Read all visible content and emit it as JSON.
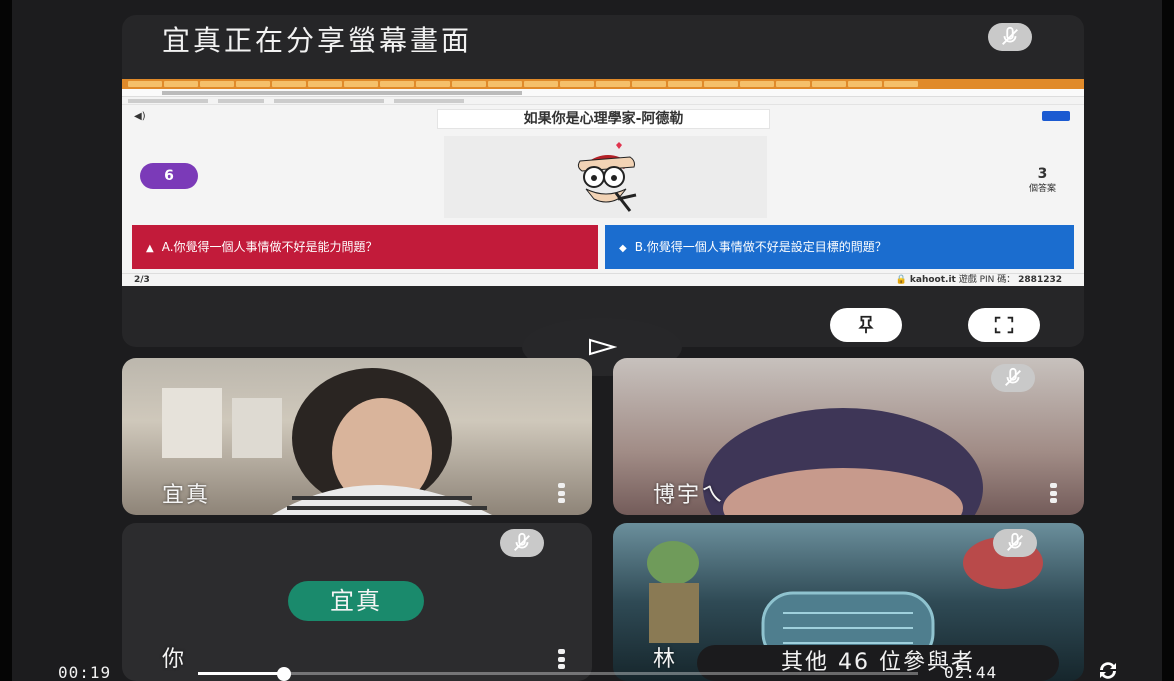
{
  "share": {
    "title": "宜真正在分享螢幕畫面"
  },
  "kahoot": {
    "question_title": "如果你是心理學家-阿德勒",
    "timer": "6",
    "answers_count": "3",
    "answers_label": "個答案",
    "answer_a": "A.你覺得一個人事情做不好是能力問題？",
    "answer_b": "B.你覺得一個人事情做不好是設定目標的問題？",
    "page": "2/3",
    "site": "kahoot.it",
    "pin_label": "遊戲 PIN 碼：",
    "pin": "2881232"
  },
  "participants": [
    {
      "name": "宜真"
    },
    {
      "name": "博宇ㄟ"
    },
    {
      "name": "你",
      "avatar": "宜真"
    },
    {
      "name": "林"
    }
  ],
  "others": "其他 46 位參與者",
  "player": {
    "current_time": "00:19",
    "duration": "02:44",
    "progress": 0.12
  },
  "colors": {
    "answer_a": "#c21b3a",
    "answer_b": "#1b6dcf",
    "timer": "#7b3ab8",
    "avatar": "#1a8a6c"
  }
}
